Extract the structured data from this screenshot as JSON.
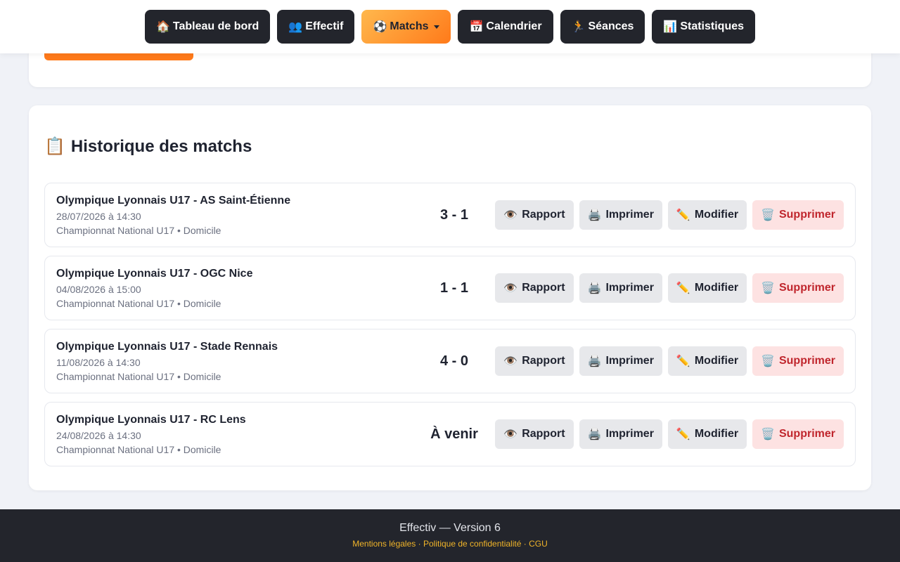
{
  "nav": {
    "items": [
      {
        "icon": "🏠",
        "label": "Tableau de bord"
      },
      {
        "icon": "👥",
        "label": "Effectif"
      },
      {
        "icon": "⚽",
        "label": "Matchs"
      },
      {
        "icon": "📅",
        "label": "Calendrier"
      },
      {
        "icon": "🏃",
        "label": "Séances"
      },
      {
        "icon": "📊",
        "label": "Statistiques"
      }
    ],
    "active_color": "#ff7a1a"
  },
  "history": {
    "icon": "📋",
    "title": "Historique des matchs",
    "matches": [
      {
        "title": "Olympique Lyonnais U17 - AS Saint-Étienne",
        "date": "28/07/2026 à 14:30",
        "meta": "Championnat National U17 • Domicile",
        "score": "3 - 1"
      },
      {
        "title": "Olympique Lyonnais U17 - OGC Nice",
        "date": "04/08/2026 à 15:00",
        "meta": "Championnat National U17 • Domicile",
        "score": "1 - 1"
      },
      {
        "title": "Olympique Lyonnais U17 - Stade Rennais",
        "date": "11/08/2026 à 14:30",
        "meta": "Championnat National U17 • Domicile",
        "score": "4 - 0"
      },
      {
        "title": "Olympique Lyonnais U17 - RC Lens",
        "date": "24/08/2026 à 14:30",
        "meta": "Championnat National U17 • Domicile",
        "score": "À venir"
      }
    ],
    "actions": {
      "report": {
        "icon": "👁️",
        "label": "Rapport"
      },
      "print": {
        "icon": "🖨️",
        "label": "Imprimer"
      },
      "edit": {
        "icon": "✏️",
        "label": "Modifier"
      },
      "delete": {
        "icon": "🗑️",
        "label": "Supprimer"
      }
    }
  },
  "footer": {
    "line": "Effectiv — Version 6",
    "links": [
      "Mentions légales",
      "Politique de confidentialité",
      "CGU"
    ],
    "separator": "·"
  }
}
